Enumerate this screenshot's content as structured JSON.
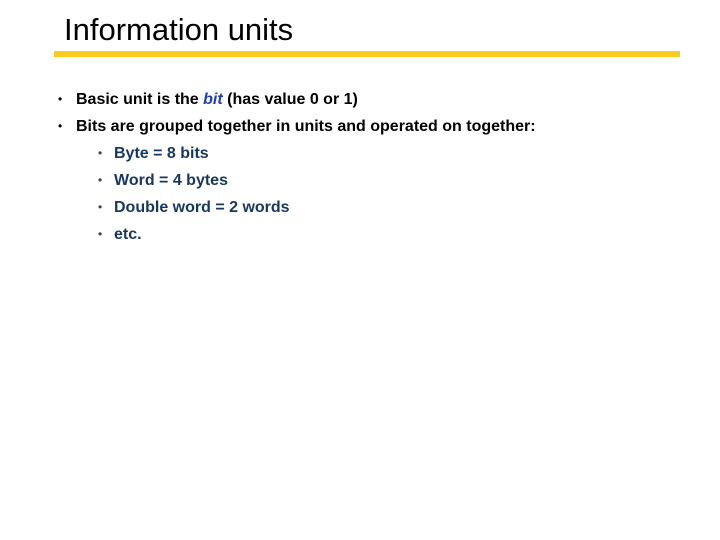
{
  "slide": {
    "title": "Information units",
    "accent_color": "#f9cb1d",
    "bullets": [
      {
        "prefix": "Basic unit is the ",
        "emphasis": "bit",
        "suffix": " (has value 0 or 1)"
      },
      {
        "text": "Bits are grouped together in units and operated on together:",
        "sub_bullets": [
          "Byte = 8 bits",
          "Word = 4 bytes",
          "Double word = 2 words",
          "etc."
        ]
      }
    ],
    "bullet_glyph": "•"
  }
}
